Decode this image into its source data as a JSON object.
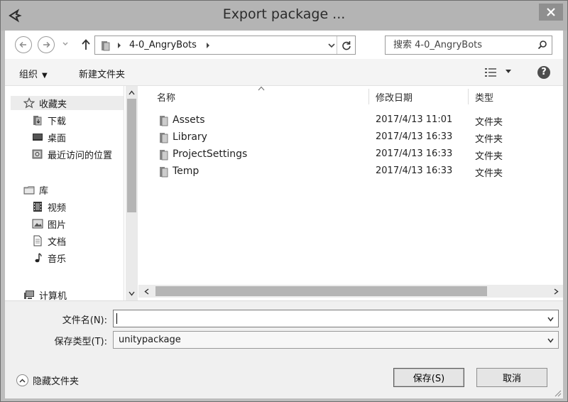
{
  "window": {
    "title": "Export package ..."
  },
  "address": {
    "crumb": "4-0_AngryBots",
    "search_placeholder": "搜索 4-0_AngryBots"
  },
  "toolbar": {
    "organize": "组织",
    "new_folder": "新建文件夹"
  },
  "nav": {
    "favorites": "收藏夹",
    "downloads": "下载",
    "desktop": "桌面",
    "recent": "最近访问的位置",
    "libraries": "库",
    "videos": "视频",
    "pictures": "图片",
    "documents": "文档",
    "music": "音乐",
    "computer": "计算机"
  },
  "columns": {
    "name": "名称",
    "date": "修改日期",
    "type": "类型"
  },
  "files": [
    {
      "name": "Assets",
      "date": "2017/4/13 11:01",
      "type": "文件夹"
    },
    {
      "name": "Library",
      "date": "2017/4/13 16:33",
      "type": "文件夹"
    },
    {
      "name": "ProjectSettings",
      "date": "2017/4/13 16:33",
      "type": "文件夹"
    },
    {
      "name": "Temp",
      "date": "2017/4/13 16:33",
      "type": "文件夹"
    }
  ],
  "form": {
    "filename_label": "文件名(N):",
    "filename_value": "",
    "filetype_label": "保存类型(T):",
    "filetype_value": "unitypackage",
    "hide_folders": "隐藏文件夹",
    "save": "保存(S)",
    "cancel": "取消"
  },
  "icons": {
    "app": "unity-logo-icon",
    "close": "close-icon",
    "back": "back-arrow-icon",
    "forward": "forward-arrow-icon",
    "up": "up-arrow-icon",
    "refresh": "refresh-icon",
    "search": "search-icon",
    "view": "view-options-icon",
    "help": "help-icon",
    "folder": "folder-icon"
  }
}
